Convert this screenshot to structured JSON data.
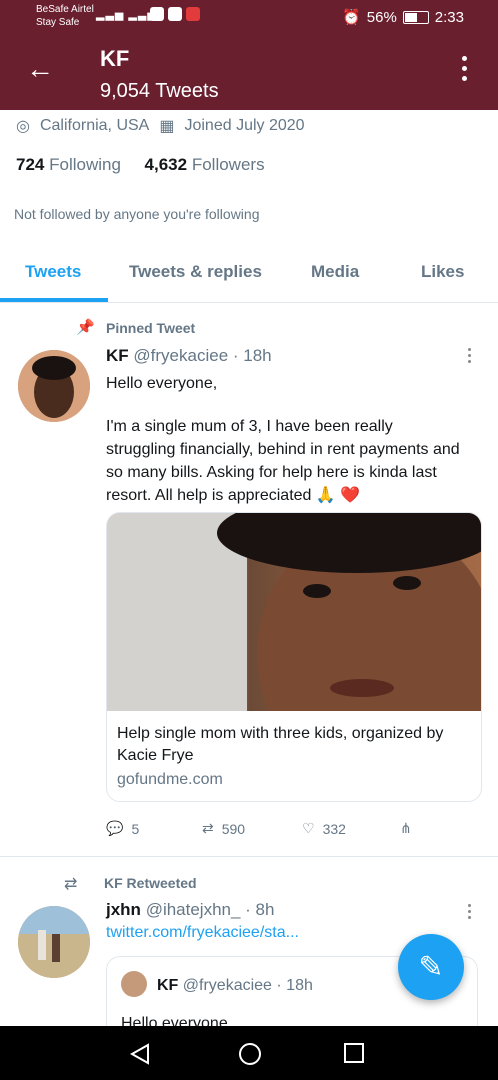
{
  "status_bar": {
    "carrier": "BeSafe Airtel",
    "carrier_sub": "Stay Safe",
    "battery": "56%",
    "time": "2:33"
  },
  "app_bar": {
    "name": "KF",
    "tweets_count": "9,054 Tweets"
  },
  "profile": {
    "location": "California, USA",
    "joined": "Joined July 2020",
    "following_count": "724",
    "following_label": "Following",
    "followers_count": "4,632",
    "followers_label": "Followers",
    "not_followed": "Not followed by anyone you're following"
  },
  "tabs": [
    {
      "label": "Tweets"
    },
    {
      "label": "Tweets & replies"
    },
    {
      "label": "Media"
    },
    {
      "label": "Likes"
    }
  ],
  "pinned_tweet": {
    "label": "Pinned Tweet",
    "author": "KF",
    "handle": "@fryekaciee · 18h",
    "line1": "Hello everyone,",
    "body": "I'm a single mum of 3, I have been really struggling financially, behind in rent payments and so many bills. Asking for help here is kinda last resort. All help is appreciated 🙏 ❤️",
    "card_title": "Help single mom with three kids, organized by Kacie Frye",
    "card_link": "gofundme.com",
    "replies": "5",
    "retweets": "590",
    "likes": "332"
  },
  "retweet": {
    "label": "KF Retweeted",
    "author": "jxhn",
    "handle": "@ihatejxhn_ · 8h",
    "link": "twitter.com/fryekaciee/sta...",
    "quote_author": "KF",
    "quote_handle": "@fryekaciee · 18h",
    "quote_text": "Hello everyone"
  },
  "colors": {
    "header": "#6a1f2f",
    "accent": "#1da1f2",
    "muted": "#657786"
  }
}
